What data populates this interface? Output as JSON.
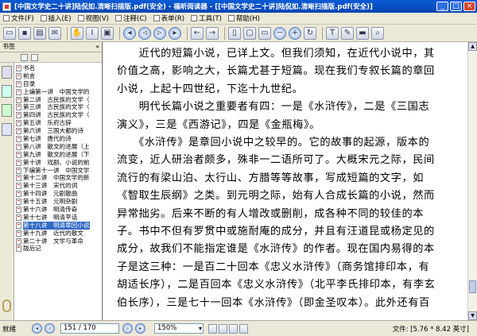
{
  "window": {
    "title": "[中国文学史二十讲]陆侃如.清晰扫描版.pdf(安全) - 福昕阅读器 - [[中国文学史二十讲]陆侃如.清晰扫描版.pdf(安全)]"
  },
  "menu": [
    "文件(F)",
    "插入(E)",
    "视图(V)",
    "注释(C)",
    "表单(R)",
    "工具(T)",
    "帮助(H)"
  ],
  "sidebar": {
    "header": "书签",
    "items": [
      {
        "label": "书名"
      },
      {
        "label": "前言"
      },
      {
        "label": "目录"
      },
      {
        "label": "上编第一讲　中国文学的"
      },
      {
        "label": "第二讲　古民族的文学（"
      },
      {
        "label": "第三讲　古民族的文学（"
      },
      {
        "label": "第四讲　古民族的文学（"
      },
      {
        "label": "第五讲　乐府古辞"
      },
      {
        "label": "第六讲　三国大都的诗"
      },
      {
        "label": "第七讲　唐代的诗"
      },
      {
        "label": "第八讲　散文的进展（上"
      },
      {
        "label": "第九讲　散文的进展（下"
      },
      {
        "label": "第十讲　戏剧、小说的前"
      },
      {
        "label": "下编第十一讲　中国文学"
      },
      {
        "label": "第十二讲　中国文学的新"
      },
      {
        "label": "第十三讲　宋代的词"
      },
      {
        "label": "第十四讲　元剧散曲"
      },
      {
        "label": "第十五讲　元明杂剧"
      },
      {
        "label": "第十六讲　明清传奇"
      },
      {
        "label": "第十七讲　明清平话"
      },
      {
        "label": "第十八讲　明清章回小说"
      },
      {
        "label": "第十九讲　近代的散文"
      },
      {
        "label": "第二十讲　文学与革命"
      },
      {
        "label": "跋后记"
      }
    ],
    "selected_index": 20
  },
  "document": {
    "lines": [
      "　　近代的短篇小说，已详上文。但我们须知，在近代小说中，其",
      "价值之高，影响之大，长篇尤甚于短篇。现在我们专叙长篇的章回",
      "小说，上起十四世纪，下迄十九世纪。",
      "　　明代长篇小说之重要者有四：一是《水浒传》，二是《三国志",
      "演义》，三是《西游记》，四是《金瓶梅》。",
      "　　《水浒传》是章回小说中之较早的。它的故事的起源，版本的",
      "流变，近人研治者颇多，殊非一二语所可了。大概宋元之际，民间",
      "流行的有梁山泊、太行山、方腊等等故事，写成短篇的文字，如",
      "《智取生辰纲》之类。到元明之际，始有人合成长篇的小说，然而",
      "异常拙劣。后来不断的有人增改或删削，成各种不同的较佳的本",
      "子。书中不但有罗贯中或施耐庵的成分，并且有汪道昆或杨定见的",
      "成分，故我们不能指定谁是《水浒传》的作者。现在国内易得的本",
      "子是这三种：一是百二十回本《忠义水浒传》（商务馆排印本，有",
      "胡适长序），二是百回本《忠义水浒传》（北平李氏排印本，有李玄",
      "伯长序），三是七十一回本《水浒传》（即金圣叹本）。此外还有百"
    ]
  },
  "status": {
    "ready": "就绪",
    "page": "151 / 170",
    "zoom": "150%",
    "file_info": "文件: [5.76 * 8.42 英寸]"
  }
}
